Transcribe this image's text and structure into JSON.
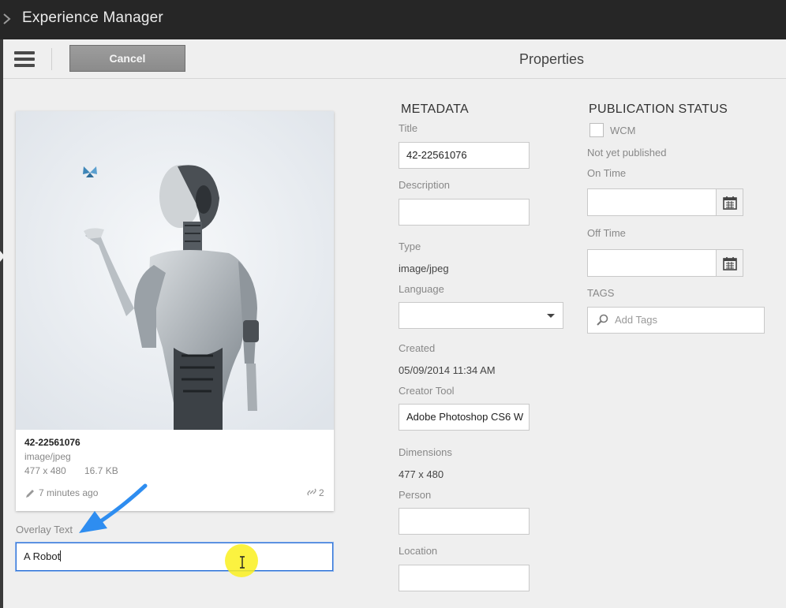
{
  "app": {
    "title": "Experience Manager"
  },
  "toolbar": {
    "cancel_label": "Cancel",
    "page_title": "Properties"
  },
  "asset_card": {
    "name": "42-22561076",
    "mime": "image/jpeg",
    "dimensions": "477 x 480",
    "size": "16.7 KB",
    "modified": "7 minutes ago",
    "link_count": "2"
  },
  "overlay": {
    "label": "Overlay Text",
    "value": "A Robot"
  },
  "metadata": {
    "heading": "METADATA",
    "title_label": "Title",
    "title_value": "42-22561076",
    "description_label": "Description",
    "description_value": "",
    "type_label": "Type",
    "type_value": "image/jpeg",
    "language_label": "Language",
    "language_value": "",
    "created_label": "Created",
    "created_value": "05/09/2014 11:34 AM",
    "creator_tool_label": "Creator Tool",
    "creator_tool_value": "Adobe Photoshop CS6 W",
    "dimensions_label": "Dimensions",
    "dimensions_value": "477 x 480",
    "person_label": "Person",
    "person_value": "",
    "location_label": "Location",
    "location_value": ""
  },
  "publication": {
    "heading": "PUBLICATION STATUS",
    "wcm_label": "WCM",
    "status_text": "Not yet published",
    "on_time_label": "On Time",
    "off_time_label": "Off Time",
    "tags_label": "TAGS",
    "tags_placeholder": "Add Tags"
  },
  "icons": [
    "chevron-right-icon",
    "hamburger-menu-icon",
    "calendar-icon",
    "search-icon",
    "pencil-icon",
    "link-icon",
    "text-cursor-icon",
    "annotation-arrow-icon"
  ]
}
